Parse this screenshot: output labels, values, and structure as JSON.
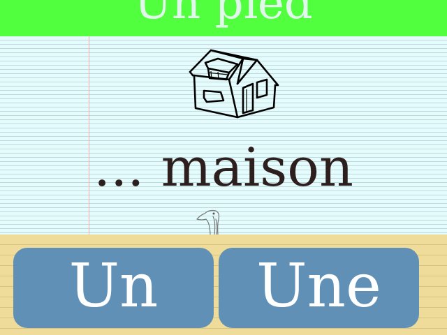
{
  "header": {
    "title": "Un pied"
  },
  "question": {
    "word": "... maison",
    "image_icon": "house-icon",
    "hint_icon": "goose-icon"
  },
  "answers": [
    {
      "label": "Un"
    },
    {
      "label": "Une"
    }
  ],
  "colors": {
    "header_bg": "#52ff3e",
    "paper_bg": "#e6fbfb",
    "answer_area_bg": "#efdb9a",
    "button_bg": "#6190b6",
    "button_text": "#ffffff"
  }
}
